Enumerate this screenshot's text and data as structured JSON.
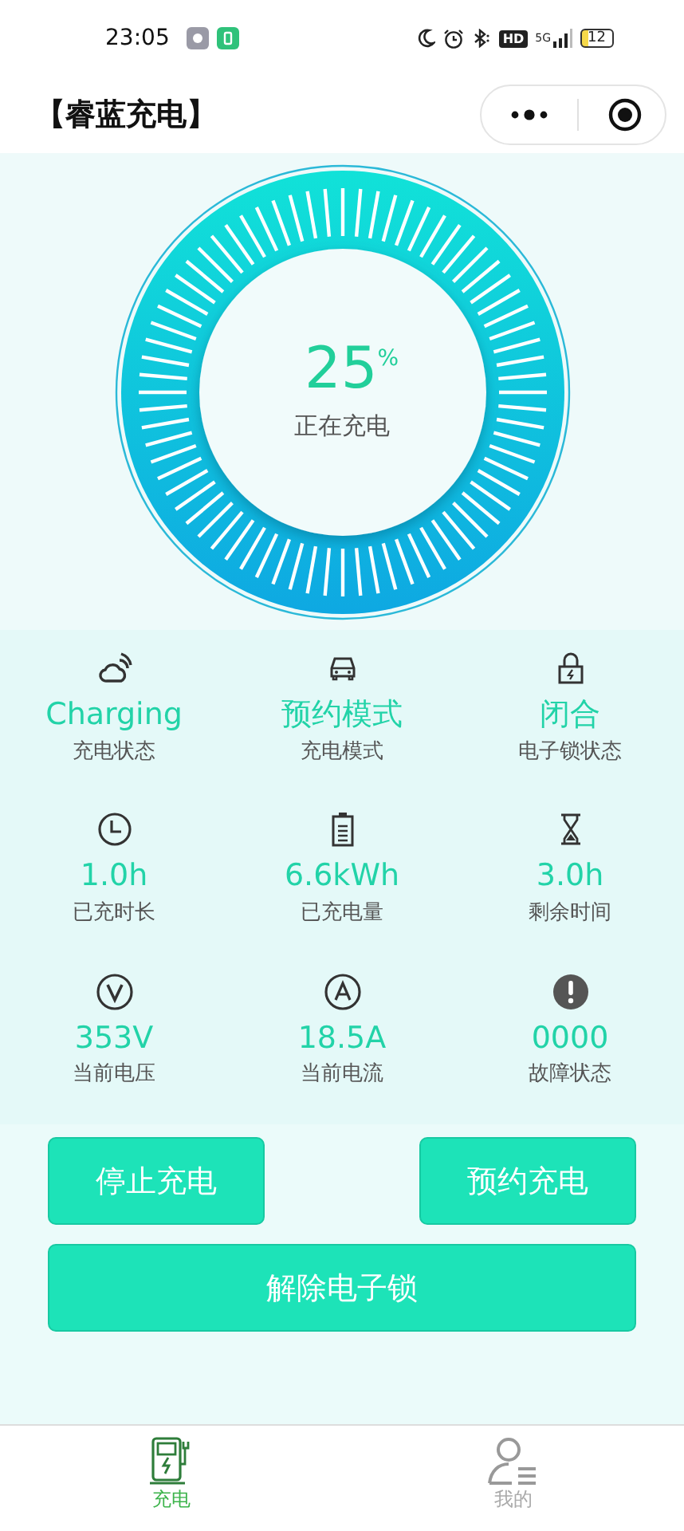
{
  "status_bar": {
    "time": "23:05",
    "hd": "HD",
    "network": "5G",
    "battery": "12"
  },
  "header": {
    "title": "【睿蓝充电】"
  },
  "gauge": {
    "value": "25",
    "unit": "%",
    "status": "正在充电"
  },
  "stats": [
    {
      "kind": "cloud",
      "value": "Charging",
      "label": "充电状态"
    },
    {
      "kind": "car",
      "value": "预约模式",
      "label": "充电模式"
    },
    {
      "kind": "lock",
      "value": "闭合",
      "label": "电子锁状态"
    },
    {
      "kind": "clock",
      "value": "1.0h",
      "label": "已充时长"
    },
    {
      "kind": "battery",
      "value": "6.6kWh",
      "label": "已充电量"
    },
    {
      "kind": "hourglass",
      "value": "3.0h",
      "label": "剩余时间"
    },
    {
      "kind": "volt",
      "value": "353V",
      "label": "当前电压"
    },
    {
      "kind": "amp",
      "value": "18.5A",
      "label": "当前电流"
    },
    {
      "kind": "alert",
      "value": "0000",
      "label": "故障状态"
    }
  ],
  "buttons": [
    "停止充电",
    "预约充电",
    "解除电子锁"
  ],
  "tabs": [
    {
      "label": "充电",
      "selected": true
    },
    {
      "label": "我的",
      "selected": false
    }
  ]
}
